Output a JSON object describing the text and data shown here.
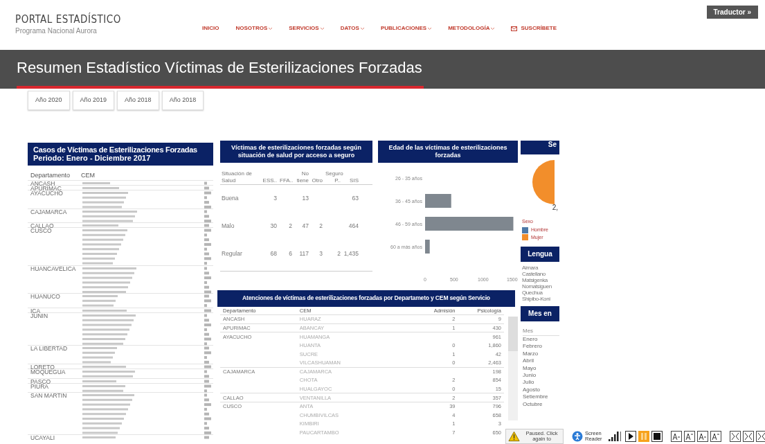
{
  "header": {
    "logo_title": "PORTAL ESTADÍSTICO",
    "logo_subtitle": "Programa Nacional Aurora"
  },
  "nav": [
    {
      "label": "INICIO",
      "dropdown": false,
      "kind": "link"
    },
    {
      "label": "NOSOTROS",
      "dropdown": true,
      "kind": "link"
    },
    {
      "label": "SERVICIOS",
      "dropdown": true,
      "kind": "link"
    },
    {
      "label": "DATOS",
      "dropdown": true,
      "kind": "link"
    },
    {
      "label": "PUBLICACIONES",
      "dropdown": true,
      "kind": "link"
    },
    {
      "label": "METODOLOGÍA",
      "dropdown": true,
      "kind": "link"
    },
    {
      "label": "SUSCRÍBETE",
      "dropdown": false,
      "kind": "mail"
    }
  ],
  "translator_button": "Traductor »",
  "page_title": "Resumen Estadístico Víctimas de Esterilizaciones Forzadas",
  "year_tabs": [
    "Año 2020",
    "Año 2019",
    "Año 2018",
    "Año 2018"
  ],
  "cases_panel": {
    "title": "Casos de Víctimas de Esterilizaciones Forzadas",
    "subtitle": "Periodo: Enero - Diciembre 2017",
    "columns": [
      "Departamento",
      "CEM"
    ],
    "departments": [
      "ANCASH",
      "APURIMAC",
      "AYACUCHO",
      "CAJAMARCA",
      "CALLAO",
      "CUSCO",
      "HUANCAVELICA",
      "HUANUCO",
      "ICA",
      "JUNIN",
      "LA LIBERTAD",
      "LORETO",
      "MOQUEGUA",
      "PASCO",
      "PIURA",
      "SAN MARTIN",
      "UCAYALI"
    ]
  },
  "health_panel": {
    "title": "Víctimas de esterilizaciones forzadas según situación de salud por acceso a seguro",
    "columns": [
      "Situación de Salud",
      "ESS..",
      "FFA..",
      "No tiene",
      "Otro",
      "Seguro P..",
      "SIS"
    ],
    "rows": [
      [
        "Buena",
        "3",
        "",
        "13",
        "",
        "",
        "63"
      ],
      [
        "Malo",
        "30",
        "2",
        "47",
        "2",
        "",
        "464"
      ],
      [
        "Regular",
        "68",
        "6",
        "117",
        "3",
        "2",
        "1,435"
      ]
    ]
  },
  "age_panel": {
    "title": "Edad de las víctimas de esterilizaciones forzadas",
    "chart_data": {
      "type": "bar",
      "orientation": "horizontal",
      "categories": [
        "26 - 35 años",
        "36 - 45 años",
        "46 - 59 años",
        "60 a más años"
      ],
      "values": [
        null,
        450,
        1520,
        80
      ],
      "xticks": [
        0,
        500,
        1000,
        1500
      ],
      "xlim": [
        0,
        1550
      ]
    }
  },
  "services_panel": {
    "title": "Atenciones de víctimas de esterilizaciones forzadas por Departameto y CEM según  Servicio",
    "columns": [
      "Departamento",
      "CEM",
      "Admisión",
      "Psicología"
    ],
    "groups": [
      {
        "department": "ANCASH",
        "rows": [
          [
            "HUARAZ",
            "2",
            "9"
          ]
        ]
      },
      {
        "department": "APURIMAC",
        "rows": [
          [
            "ABANCAY",
            "1",
            "430"
          ]
        ]
      },
      {
        "department": "AYACUCHO",
        "rows": [
          [
            "HUAMANGA",
            "",
            "961"
          ],
          [
            "HUANTA",
            "0",
            "1,860"
          ],
          [
            "SUCRE",
            "1",
            "42"
          ],
          [
            "VILCASHUAMAN",
            "0",
            "2,463"
          ]
        ]
      },
      {
        "department": "CAJAMARCA",
        "rows": [
          [
            "CAJAMARCA",
            "",
            "198"
          ],
          [
            "CHOTA",
            "2",
            "854"
          ],
          [
            "HUALGAYOC",
            "0",
            "15"
          ]
        ]
      },
      {
        "department": "CALLAO",
        "rows": [
          [
            "VENTANILLA",
            "2",
            "357"
          ]
        ]
      },
      {
        "department": "CUSCO",
        "rows": [
          [
            "ANTA",
            "39",
            "796"
          ],
          [
            "CHUMBIVILCAS",
            "4",
            "658"
          ],
          [
            "KIMBIRI",
            "1",
            "3"
          ],
          [
            "PAUCARTAMBO",
            "7",
            "650"
          ]
        ]
      }
    ]
  },
  "sex_panel": {
    "title": "Se",
    "pie_label": "2,",
    "legend_title": "Sexo",
    "legend": [
      {
        "label": "Hombre",
        "color": "#4e79a7"
      },
      {
        "label": "Mujer",
        "color": "#f28e2b"
      }
    ]
  },
  "language_panel": {
    "title": "Lengua",
    "items": [
      "Aimara",
      "Castellano",
      "Matsigenka",
      "Nomatsiguen",
      "Quechua",
      "Shipibo-Koni"
    ]
  },
  "month_panel": {
    "title": "Mes en",
    "column": "Mes",
    "items": [
      "Enero",
      "Febrero",
      "Marzo",
      "Abril",
      "Mayo",
      "Junio",
      "Julio",
      "Agosto",
      "Setiembre",
      "Octubre"
    ]
  },
  "reader_toolbar": {
    "paused_text": "Paused. Click again to",
    "reader_label": "Screen Reader"
  }
}
